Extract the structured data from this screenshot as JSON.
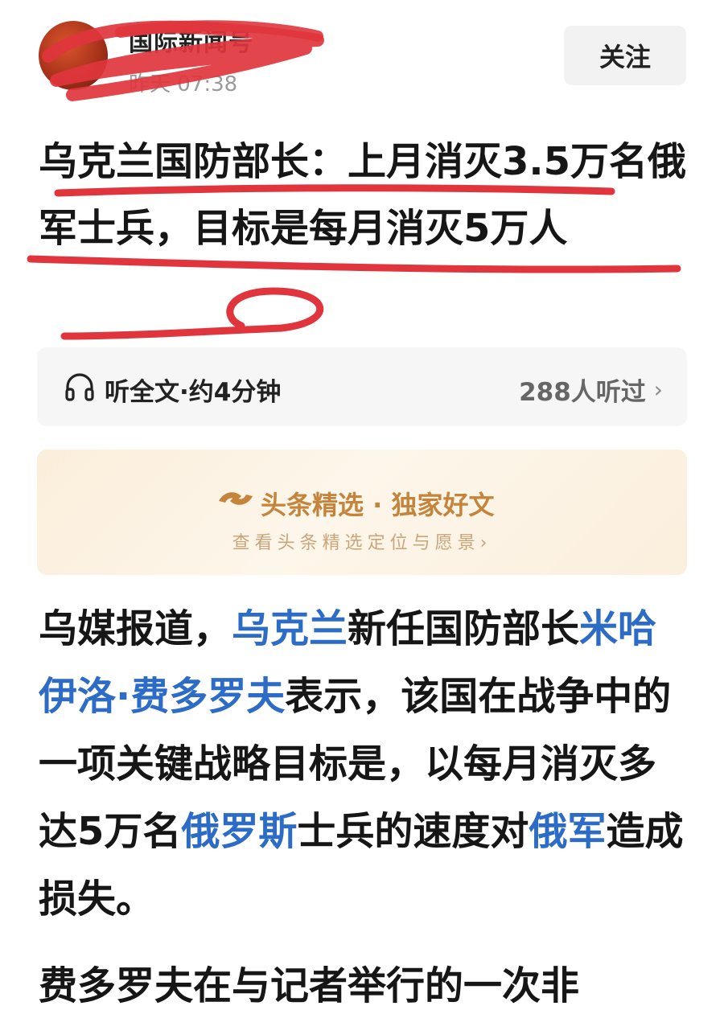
{
  "header": {
    "author_name": "国际新闻号",
    "post_time": "昨天 07:38",
    "follow_label": "关注"
  },
  "article": {
    "title": "乌克兰国防部长：上月消灭3.5万名俄军士兵，目标是每月消灭5万人"
  },
  "audio": {
    "listen_label": "听全文·约4分钟",
    "listeners_label": "288人听过"
  },
  "promo": {
    "title": "头条精选 · 独家好文",
    "subtitle": "查看头条精选定位与愿景"
  },
  "body": {
    "p1_a": "乌媒报道，",
    "p1_link1": "乌克兰",
    "p1_b": "新任国防部长",
    "p1_link2": "米哈伊洛·费多罗夫",
    "p1_c": "表示，该国在战争中的一项关键战略目标是，以每月消灭多达5万名",
    "p1_link3": "俄罗斯",
    "p1_d": "士兵的速度对",
    "p1_link4": "俄军",
    "p1_e": "造成损失。",
    "cutoff_line": "费多罗夫在与记者举行的一次非"
  },
  "colors": {
    "link": "#2c6bc6",
    "scribble": "#e0353d",
    "promo_accent": "#c4843c"
  }
}
